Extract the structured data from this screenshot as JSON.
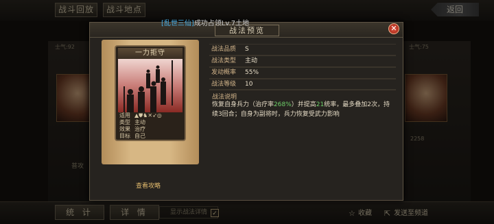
{
  "top": {
    "btn_replay": "战斗回放",
    "btn_location": "战斗地点",
    "back": "返回"
  },
  "side": {
    "left_morale": "士气:92",
    "right_morale": "士气:75",
    "left_attack": "普攻",
    "right_num": "2258"
  },
  "bottom": {
    "stats": "统 计",
    "detail": "详 情",
    "toggle_label": "显示战法详情",
    "fav": "收藏",
    "share": "发送至频道"
  },
  "tooltip": {
    "tag": "[乱世三仙]",
    "text": "成功占领Lv.7土地"
  },
  "dialog": {
    "title": "战法预览",
    "close_icon": "close-icon"
  },
  "card": {
    "name": "一力拒守",
    "stats": [
      {
        "k": "适用",
        "v": "▲⛊♞✕➶◎"
      },
      {
        "k": "类型",
        "v": "主动"
      },
      {
        "k": "效果",
        "v": "治疗"
      },
      {
        "k": "目标",
        "v": "自己"
      }
    ]
  },
  "info": [
    {
      "k": "战法品质",
      "v": "S"
    },
    {
      "k": "战法类型",
      "v": "主动"
    },
    {
      "k": "发动概率",
      "v": "55%"
    },
    {
      "k": "战法等级",
      "v": "10"
    }
  ],
  "desc": {
    "label": "战法说明",
    "p1": "恢复自身兵力（治疗率",
    "rate": "268%",
    "p2": "）并提高",
    "rate2": "21",
    "p3": "统率，最多叠加2次，持续3回合；自身为副将时，兵力恢复受武力影响"
  },
  "guide": "查看攻略"
}
